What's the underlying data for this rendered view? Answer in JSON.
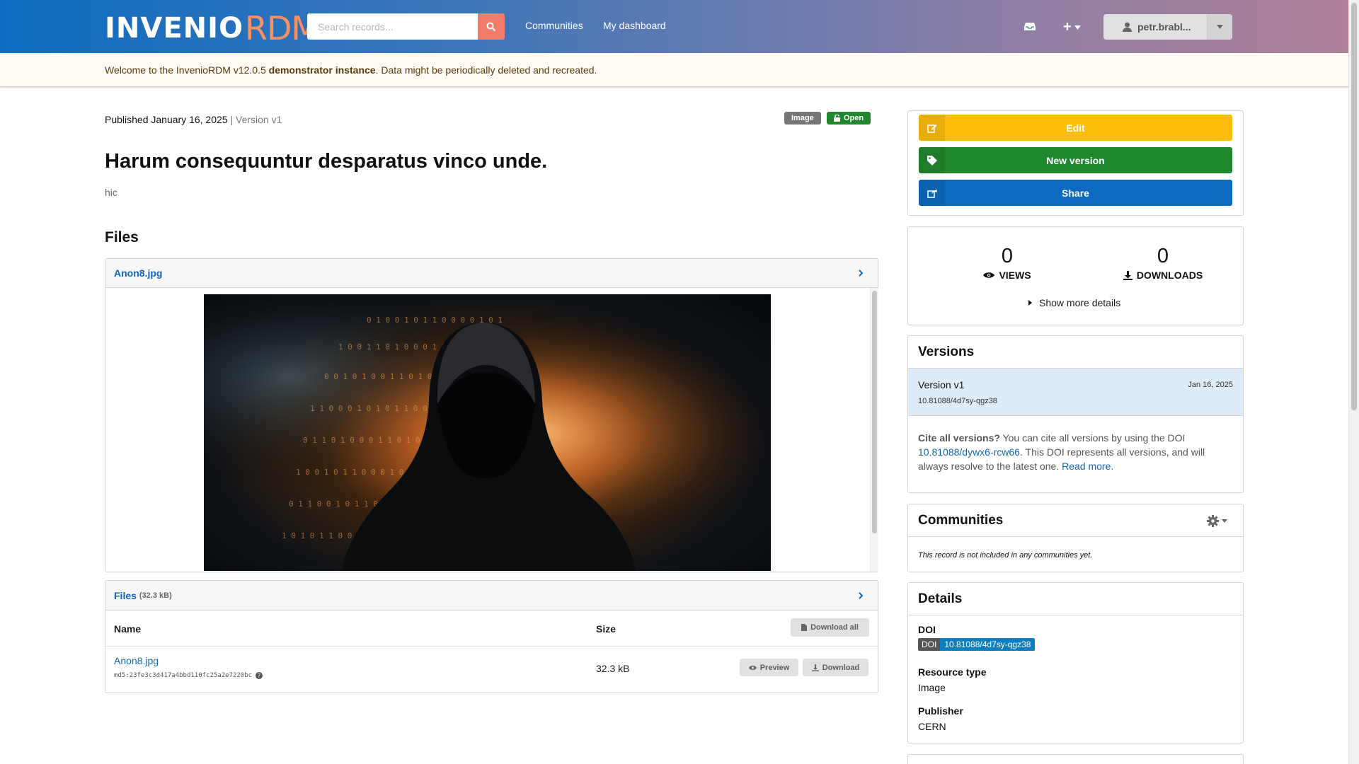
{
  "header": {
    "logo_invenio": "INVENIO",
    "logo_rdm": "RDM",
    "search_placeholder": "Search records...",
    "nav": [
      "Communities",
      "My dashboard"
    ],
    "user_label": "petr.brabl..."
  },
  "banner": {
    "prefix": "Welcome to the InvenioRDM v12.0.5 ",
    "bold": "demonstrator instance",
    "suffix": ". Data might be periodically deleted and recreated."
  },
  "record": {
    "published": "Published January 16, 2025",
    "separator": " | ",
    "version": "Version v1",
    "resource_label": "Image",
    "access_label": "Open",
    "title": "Harum consequuntur desparatus vinco unde.",
    "description": "hic"
  },
  "files": {
    "heading": "Files",
    "preview_file": "Anon8.jpg",
    "list_title": "Files",
    "list_size": "(32.3 kB)",
    "col_name": "Name",
    "col_size": "Size",
    "download_all": "Download all",
    "rows": [
      {
        "name": "Anon8.jpg",
        "checksum": "md5:23fe3c3d417a4bbd110fc25a2e7220bc",
        "size": "32.3 kB",
        "preview": "Preview",
        "download": "Download"
      }
    ]
  },
  "actions": {
    "edit": "Edit",
    "new_version": "New version",
    "share": "Share",
    "colors": {
      "edit": "#fbbd08",
      "new_version": "#21872e",
      "share": "#0d6bbf"
    }
  },
  "stats": {
    "views_count": "0",
    "views_label": "VIEWS",
    "downloads_count": "0",
    "downloads_label": "DOWNLOADS",
    "more_details": "Show more details"
  },
  "versions": {
    "title": "Versions",
    "current_label": "Version v1",
    "current_date": "Jan 16, 2025",
    "current_doi": "10.81088/4d7sy-qgz38",
    "cite_bold": "Cite all versions?",
    "cite_text_1": " You can cite all versions by using the DOI ",
    "cite_doi": "10.81088/dywx6-rcw66",
    "cite_text_2": ". This DOI represents all versions, and will always resolve to the latest one. ",
    "read_more": "Read more",
    "read_more_end": "."
  },
  "communities": {
    "title": "Communities",
    "empty_text": "This record is not included in any communities yet."
  },
  "details": {
    "title": "Details",
    "doi_label": "DOI",
    "doi_badge": "DOI",
    "doi_value": "10.81088/4d7sy-qgz38",
    "resource_type_label": "Resource type",
    "resource_type_value": "Image",
    "publisher_label": "Publisher",
    "publisher_value": "CERN"
  }
}
